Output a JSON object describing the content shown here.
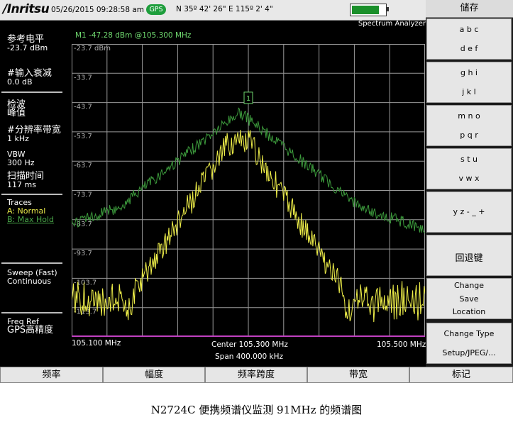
{
  "header": {
    "logo": "/Inritsu",
    "datetime": "05/26/2015 09:28:58 am",
    "gps": "GPS",
    "coords": "N 35º 42' 26\" E 115º 2' 4\"",
    "battery_level": 0.82,
    "mode": "Spectrum Analyzer"
  },
  "marker": {
    "readout": "M1 -47.28 dBm @105.300 MHz",
    "label": "1"
  },
  "left_panel": {
    "ref_level_label": "参考电平",
    "ref_level_value": "-23.7 dBm",
    "atten_label": "#输入衰减",
    "atten_value": "0.0 dB",
    "detect_label": "检波",
    "detect_value": "峰值",
    "rbw_label": "#分辨率带宽",
    "rbw_value": "1 kHz",
    "vbw_label": "VBW",
    "vbw_value": "300 Hz",
    "sweep_time_label": "扫描时间",
    "sweep_time_value": "117 ms",
    "traces_label": "Traces",
    "trace_a": "A: Normal",
    "trace_b": "B: Max Hold",
    "sweep_label": "Sweep (Fast)",
    "sweep_value": "Continuous",
    "freq_ref_label": "Freq Ref",
    "freq_ref_value": "GPS高精度"
  },
  "plot": {
    "y_ticks": [
      "-23.7 dBm",
      "-33.7",
      "-43.7",
      "-53.7",
      "-63.7",
      "-73.7",
      "-83.7",
      "-93.7",
      "-103.7",
      "-113.7"
    ],
    "x_left": "105.100 MHz",
    "x_center": "Center 105.300 MHz",
    "x_right": "105.500 MHz",
    "span": "Span 400.000 kHz",
    "colors": {
      "grid": "#9a9a9a",
      "trace_a": "#f0f04a",
      "trace_b": "#3c9a3c",
      "marker": "#6fd86f"
    }
  },
  "softkeys": {
    "title": "储存",
    "k1_top": "a b c",
    "k1_bottom": "d e f",
    "k2_top": "g h i",
    "k2_bottom": "j k l",
    "k3_top": "m n o",
    "k3_bottom": "p q r",
    "k4_top": "s t u",
    "k4_bottom": "v w x",
    "k5": "y z - _ +",
    "k6": "回退键",
    "k7_l1": "Change",
    "k7_l2": "Save",
    "k7_l3": "Location",
    "k8_top": "Change Type",
    "k8_bottom": "Setup/JPEG/..."
  },
  "bottom_keys": [
    "频率",
    "幅度",
    "频率跨度",
    "带宽",
    "标记"
  ],
  "caption": "N2724C 便携频谱仪监测 91MHz 的频谱图"
}
